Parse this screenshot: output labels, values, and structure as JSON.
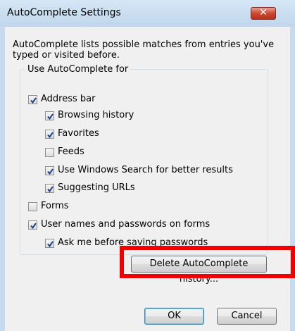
{
  "window": {
    "title": "AutoComplete Settings",
    "close_symbol": "✕"
  },
  "description": "AutoComplete lists possible matches from entries you've typed or visited before.",
  "group": {
    "legend": "Use AutoComplete for"
  },
  "options": {
    "address_bar": {
      "label": "Address bar",
      "checked": true
    },
    "browsing_history": {
      "label": "Browsing history",
      "checked": true
    },
    "favorites": {
      "label": "Favorites",
      "checked": true
    },
    "feeds": {
      "label": "Feeds",
      "checked": false
    },
    "windows_search": {
      "label": "Use Windows Search for better results",
      "checked": true
    },
    "suggesting_urls": {
      "label": "Suggesting URLs",
      "checked": true
    },
    "forms": {
      "label": "Forms",
      "checked": false
    },
    "user_names_passwords": {
      "label": "User names and passwords on forms",
      "checked": true
    },
    "ask_before_saving": {
      "label": "Ask me before saving passwords",
      "checked": true
    }
  },
  "buttons": {
    "delete_history": "Delete AutoComplete history...",
    "ok": "OK",
    "cancel": "Cancel"
  },
  "colors": {
    "highlight": "#ee0000",
    "titlebar": "#c6dbee",
    "close_button": "#c9482f"
  },
  "icons": {
    "check": "check-icon",
    "close": "close-icon"
  }
}
